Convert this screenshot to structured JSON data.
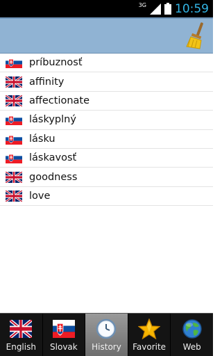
{
  "status": {
    "network": "3G",
    "time": "10:59",
    "clock_color": "#33b5e5"
  },
  "header": {
    "background": "#90b3d3",
    "clear_icon": "broom-icon"
  },
  "history": [
    {
      "word": "príbuznosť",
      "flag": "sk-flag-icon"
    },
    {
      "word": "affinity",
      "flag": "uk-flag-icon"
    },
    {
      "word": "affectionate",
      "flag": "uk-flag-icon"
    },
    {
      "word": "láskyplný",
      "flag": "sk-flag-icon"
    },
    {
      "word": "lásku",
      "flag": "sk-flag-icon"
    },
    {
      "word": "láskavosť",
      "flag": "sk-flag-icon"
    },
    {
      "word": "goodness",
      "flag": "uk-flag-icon"
    },
    {
      "word": "love",
      "flag": "uk-flag-icon"
    }
  ],
  "tabs": [
    {
      "label": "English",
      "icon": "uk-flag-icon",
      "active": false
    },
    {
      "label": "Slovak",
      "icon": "sk-flag-icon",
      "active": false
    },
    {
      "label": "History",
      "icon": "clock-icon",
      "active": true
    },
    {
      "label": "Favorite",
      "icon": "star-icon",
      "active": false
    },
    {
      "label": "Web",
      "icon": "globe-icon",
      "active": false
    }
  ]
}
